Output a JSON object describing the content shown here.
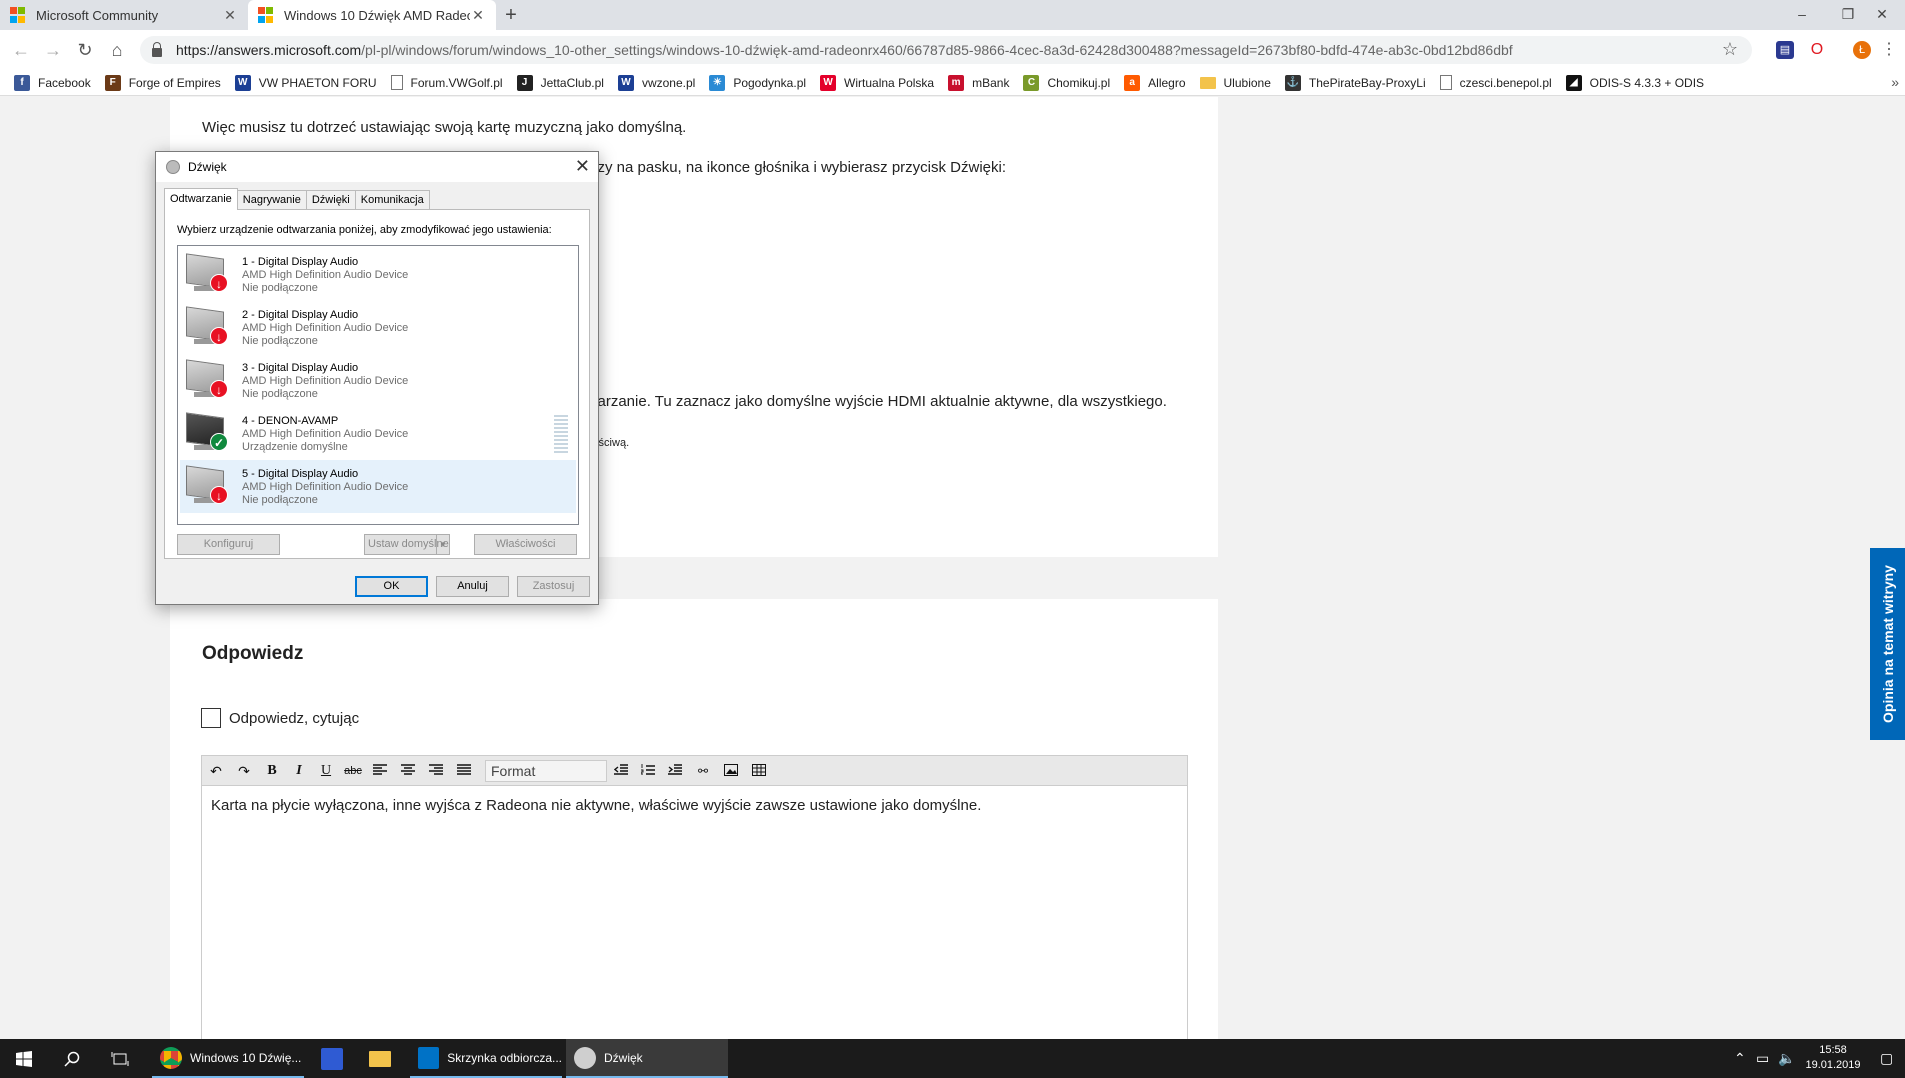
{
  "browser": {
    "tabs": [
      {
        "title": "Microsoft Community",
        "active": false
      },
      {
        "title": "Windows 10 Dźwięk AMD Radeo",
        "active": true
      }
    ],
    "url_host": "https://answers.microsoft.com",
    "url_path": "/pl-pl/windows/forum/windows_10-other_settings/windows-10-dźwięk-amd-radeonrx460/66787d85-9866-4cec-8a3d-62428d300488?messageId=2673bf80-bdfd-474e-ab3c-0bd12bd86dbf",
    "profile_initial": "Ł",
    "bookmarks": [
      {
        "label": "Facebook",
        "icon": "facebook-icon",
        "color": "#3b5998",
        "glyph": "f"
      },
      {
        "label": "Forge of Empires",
        "icon": "forge-icon",
        "color": "#6b3a17",
        "glyph": "F"
      },
      {
        "label": "VW PHAETON FORU",
        "icon": "vw-icon",
        "color": "#1c3f94",
        "glyph": "W"
      },
      {
        "label": "Forum.VWGolf.pl",
        "icon": "page-icon",
        "color": "",
        "glyph": ""
      },
      {
        "label": "JettaClub.pl",
        "icon": "jetta-icon",
        "color": "#222222",
        "glyph": "J"
      },
      {
        "label": "vwzone.pl",
        "icon": "vw-icon",
        "color": "#1c3f94",
        "glyph": "W"
      },
      {
        "label": "Pogodynka.pl",
        "icon": "weather-icon",
        "color": "#2a8ad4",
        "glyph": "☀"
      },
      {
        "label": "Wirtualna Polska",
        "icon": "wp-icon",
        "color": "#e4002b",
        "glyph": "W"
      },
      {
        "label": "mBank",
        "icon": "mbank-icon",
        "color": "#c8102e",
        "glyph": "m"
      },
      {
        "label": "Chomikuj.pl",
        "icon": "chomikuj-icon",
        "color": "#7a9a2a",
        "glyph": "C"
      },
      {
        "label": "Allegro",
        "icon": "allegro-icon",
        "color": "#ff5a00",
        "glyph": "a"
      },
      {
        "label": "Ulubione",
        "icon": "folder-icon",
        "color": "",
        "glyph": ""
      },
      {
        "label": "ThePirateBay-ProxyLi",
        "icon": "pirate-icon",
        "color": "#333333",
        "glyph": "⚓"
      },
      {
        "label": "czesci.benepol.pl",
        "icon": "page-icon",
        "color": "",
        "glyph": ""
      },
      {
        "label": "ODIS-S 4.3.3 + ODIS",
        "icon": "odis-icon",
        "color": "#111111",
        "glyph": "◢"
      }
    ]
  },
  "article": {
    "line1": "Więc musisz tu dotrzeć ustawiając swoją kartę muzyczną jako domyślną.",
    "line2_tail": "szy na pasku, na ikonce głośnika i wybierasz przycisk Dźwięki:",
    "line3_tail": "varzanie. Tu zaznacz jako domyślne wyjście HDMI aktualnie aktywne, dla wszystkiego.",
    "line4_tail": "łaściwą."
  },
  "reply": {
    "heading": "Odpowiedz",
    "quote_label": "Odpowiedz, cytując",
    "format_label": "Format",
    "editor_text": "Karta na płycie wyłączona, inne wyjśca z Radeona nie aktywne, właściwe wyjście zawsze ustawione jako domyślne."
  },
  "feedback_tab": "Opinia na temat witryny",
  "dialog": {
    "title": "Dźwięk",
    "tabs": [
      "Odtwarzanie",
      "Nagrywanie",
      "Dźwięki",
      "Komunikacja"
    ],
    "instruction": "Wybierz urządzenie odtwarzania poniżej, aby zmodyfikować jego ustawienia:",
    "devices": [
      {
        "name": "1 - Digital Display Audio",
        "driver": "AMD High Definition Audio Device",
        "status": "Nie podłączone",
        "state": "disconnected"
      },
      {
        "name": "2 - Digital Display Audio",
        "driver": "AMD High Definition Audio Device",
        "status": "Nie podłączone",
        "state": "disconnected"
      },
      {
        "name": "3 - Digital Display Audio",
        "driver": "AMD High Definition Audio Device",
        "status": "Nie podłączone",
        "state": "disconnected"
      },
      {
        "name": "4 - DENON-AVAMP",
        "driver": "AMD High Definition Audio Device",
        "status": "Urządzenie domyślne",
        "state": "default"
      },
      {
        "name": "5 - Digital Display Audio",
        "driver": "AMD High Definition Audio Device",
        "status": "Nie podłączone",
        "state": "disconnected"
      }
    ],
    "configure": "Konfiguruj",
    "set_default": "Ustaw domyślne",
    "properties": "Właściwości",
    "ok": "OK",
    "cancel": "Anuluj",
    "apply": "Zastosuj"
  },
  "taskbar": {
    "apps": [
      {
        "label": "Windows 10 Dźwię...",
        "icon": "chrome-icon"
      },
      {
        "label": "Skrzynka odbiorcza...",
        "icon": "outlook-icon"
      },
      {
        "label": "Dźwięk",
        "icon": "speaker-icon"
      }
    ],
    "time": "15:58",
    "date": "19.01.2019"
  }
}
